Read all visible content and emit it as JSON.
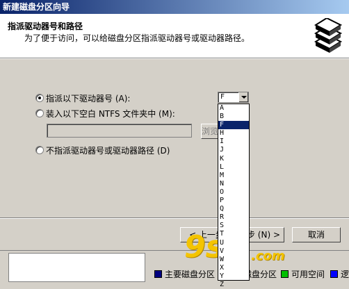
{
  "window": {
    "title": "新建磁盘分区向导"
  },
  "header": {
    "title": "指派驱动器号和路径",
    "subtitle": "为了便于访问，可以给磁盘分区指派驱动器号或驱动器路径。",
    "icon": "disk-stack-icon"
  },
  "options": {
    "assign_letter": "指派以下驱动器号 (A):",
    "mount_folder": "装入以下空白 NTFS 文件夹中 (M):",
    "no_assign": "不指派驱动器号或驱动器路径 (D)",
    "selected": "assign_letter"
  },
  "drive_combo": {
    "value": "F",
    "items": [
      "A",
      "B",
      "F",
      "H",
      "I",
      "J",
      "K",
      "L",
      "M",
      "N",
      "O",
      "P",
      "Q",
      "R",
      "S",
      "T",
      "U",
      "V",
      "W",
      "X",
      "Y",
      "Z"
    ],
    "highlighted": "F"
  },
  "folder_path": {
    "value": "",
    "browse_label": "浏览"
  },
  "buttons": {
    "back": "< 上一步",
    "next": "步 (N) >",
    "cancel": "取消"
  },
  "background_legend": {
    "primary": "主要磁盘分区",
    "extended": "磁盘分区",
    "free": "可用空间",
    "logical": "逻"
  },
  "watermark": {
    "text": "9su",
    "domain": ".com"
  },
  "colors": {
    "title_bar": "#0a246a",
    "selection": "#0a246a",
    "primary_swatch": "#000080",
    "free_swatch": "#00c000",
    "logical_swatch": "#0000ff",
    "watermark": "#f4c400"
  }
}
